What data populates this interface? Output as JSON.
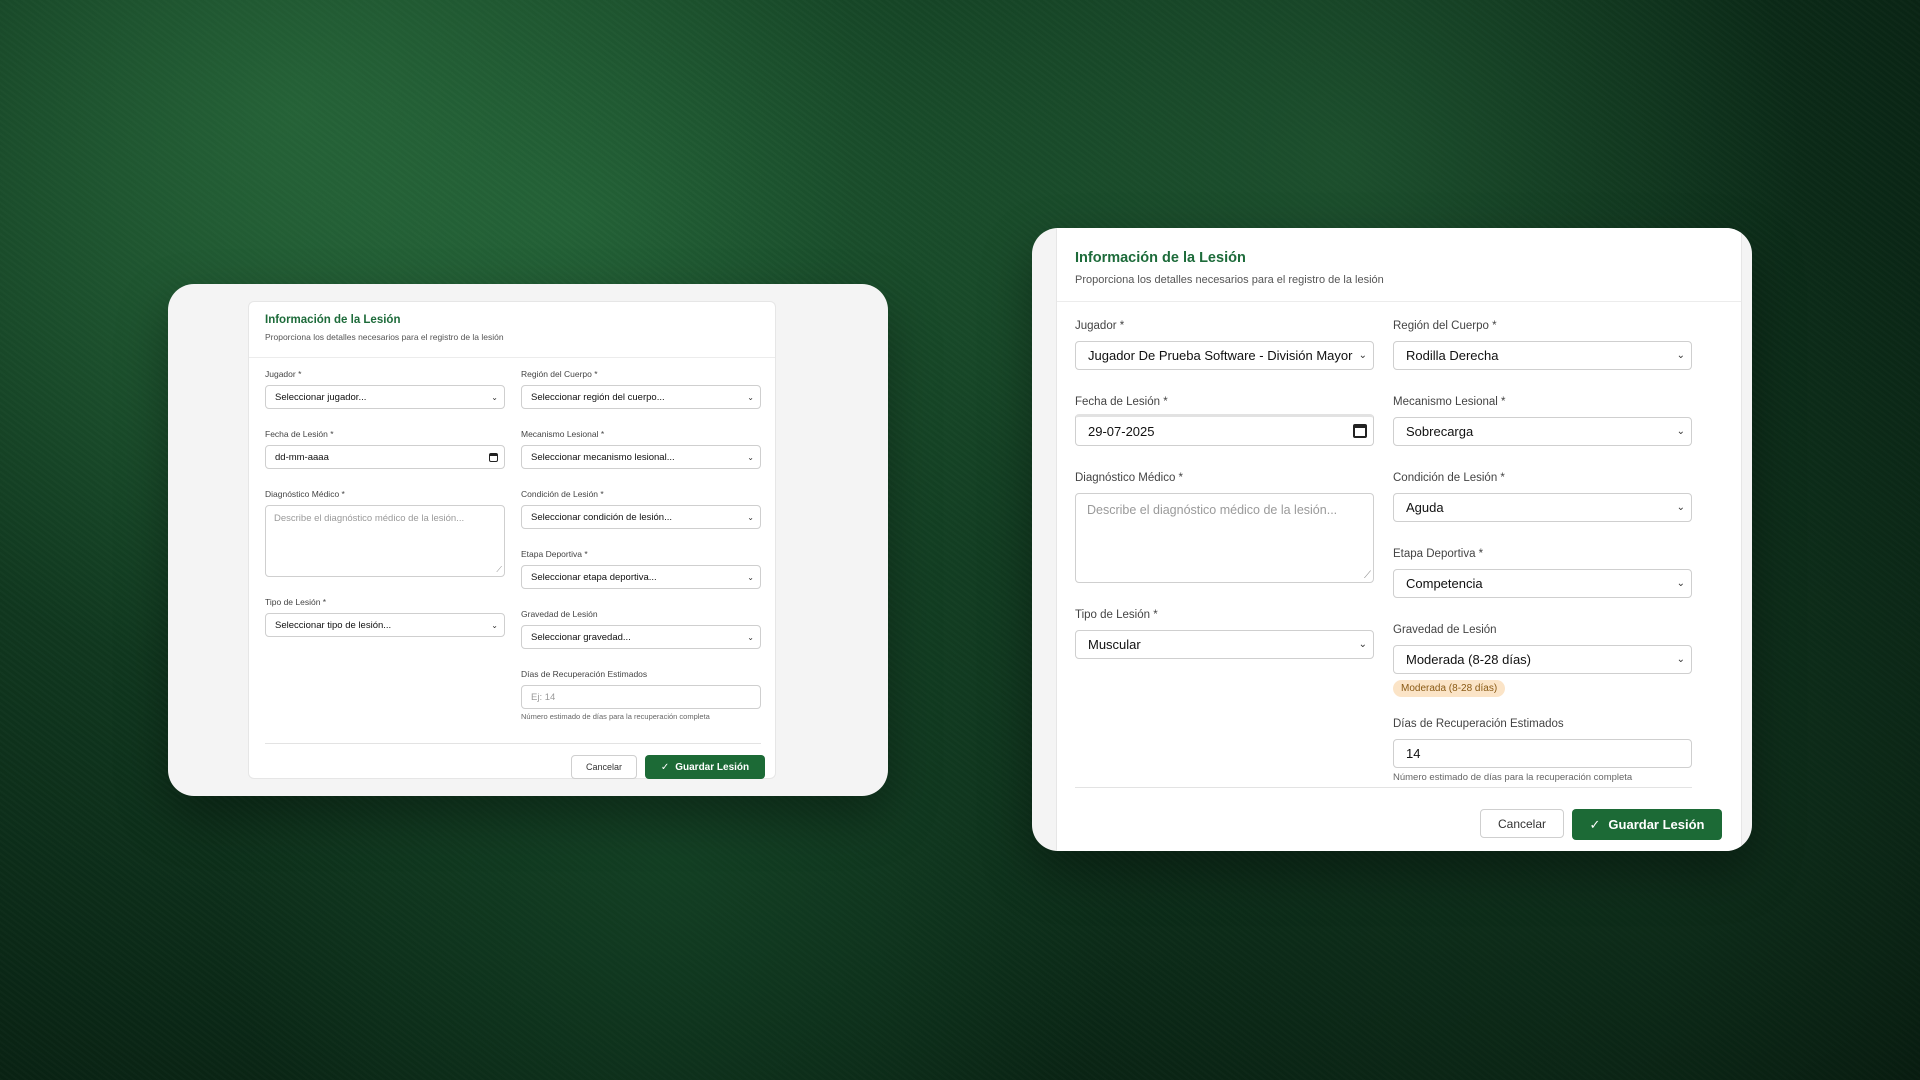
{
  "title": "Información de la Lesión",
  "subtitle": "Proporciona los detalles necesarios para el registro de la lesión",
  "labels": {
    "jugador": "Jugador *",
    "region": "Región del Cuerpo *",
    "fecha": "Fecha de Lesión *",
    "mecanismo": "Mecanismo Lesional *",
    "diagnostico": "Diagnóstico Médico *",
    "condicion": "Condición de Lesión *",
    "etapa": "Etapa Deportiva *",
    "tipo": "Tipo de Lesión *",
    "gravedad": "Gravedad de Lesión",
    "dias": "Días de Recuperación Estimados"
  },
  "hint_dias": "Número estimado de días para la recuperación completa",
  "buttons": {
    "cancel": "Cancelar",
    "save": "Guardar Lesión",
    "save_icon": "✓"
  },
  "empty_form": {
    "jugador": "Seleccionar jugador...",
    "region": "Seleccionar región del cuerpo...",
    "fecha": "dd-mm-aaaa",
    "mecanismo": "Seleccionar mecanismo lesional...",
    "diagnostico_placeholder": "Describe el diagnóstico médico de la lesión...",
    "condicion": "Seleccionar condición de lesión...",
    "etapa": "Seleccionar etapa deportiva...",
    "tipo": "Seleccionar tipo de lesión...",
    "gravedad": "Seleccionar gravedad...",
    "dias_placeholder": "Ej: 14"
  },
  "filled_form": {
    "jugador": "Jugador De Prueba Software - División Mayor",
    "region": "Rodilla Derecha",
    "fecha": "29-07-2025",
    "mecanismo": "Sobrecarga",
    "diagnostico_placeholder": "Describe el diagnóstico médico de la lesión...",
    "condicion": "Aguda",
    "etapa": "Competencia",
    "tipo": "Muscular",
    "gravedad": "Moderada (8-28 días)",
    "gravedad_badge": "Moderada (8-28 días)",
    "dias": "14"
  },
  "icons": {
    "chevron": "chevron-down-icon",
    "calendar": "calendar-icon",
    "check": "check-icon"
  },
  "colors": {
    "accent": "#1d6b3a",
    "save_button": "#1c6a36",
    "badge_bg": "#fbe4c7",
    "badge_text": "#8a5a14"
  }
}
